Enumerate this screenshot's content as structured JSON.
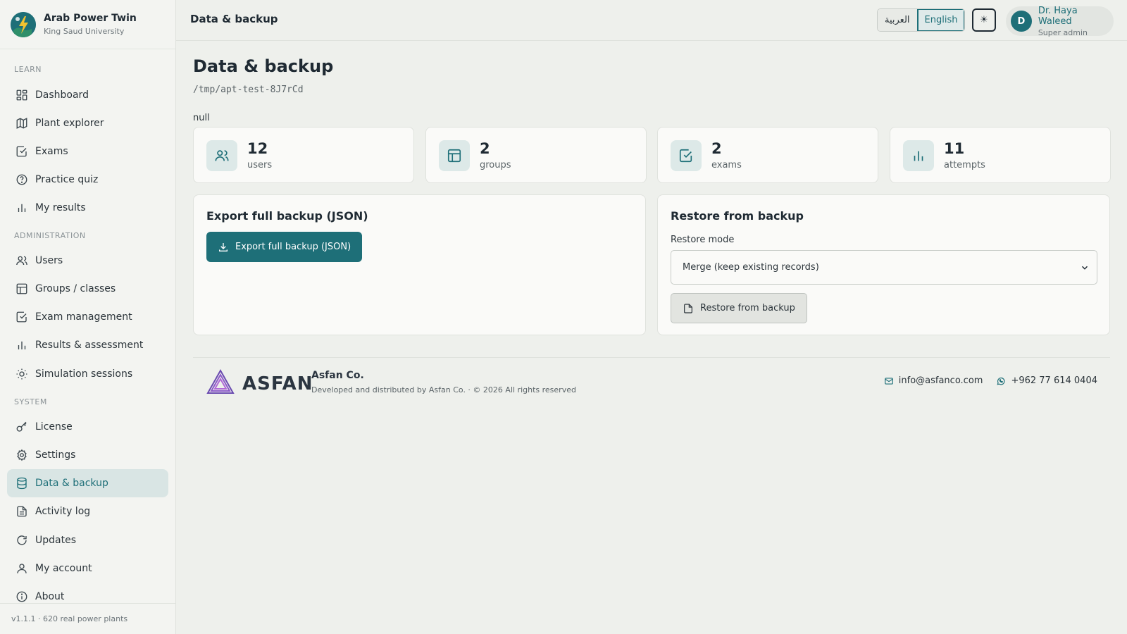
{
  "app": {
    "title": "Arab Power Twin",
    "org": "King Saud University",
    "version": "v1.1.1 · 620 real power plants"
  },
  "colors": {
    "accent": "#1e6f78",
    "background": "#eef0ec",
    "card": "#fafaf8"
  },
  "sidebar": {
    "sections": {
      "learn": "LEARN",
      "admin": "ADMINISTRATION",
      "system": "SYSTEM"
    },
    "items": [
      {
        "label": "Dashboard",
        "icon": "dashboard-icon"
      },
      {
        "label": "Plant explorer",
        "icon": "map-icon"
      },
      {
        "label": "Exams",
        "icon": "checkbox-icon"
      },
      {
        "label": "Practice quiz",
        "icon": "help-circle-icon"
      },
      {
        "label": "My results",
        "icon": "bar-chart-icon"
      },
      {
        "label": "Users",
        "icon": "users-icon"
      },
      {
        "label": "Groups / classes",
        "icon": "table-icon"
      },
      {
        "label": "Exam management",
        "icon": "checkbox-icon"
      },
      {
        "label": "Results & assessment",
        "icon": "bar-chart-icon"
      },
      {
        "label": "Simulation sessions",
        "icon": "sun-icon"
      },
      {
        "label": "License",
        "icon": "key-icon"
      },
      {
        "label": "Settings",
        "icon": "gear-icon"
      },
      {
        "label": "Data & backup",
        "icon": "database-icon",
        "active": true
      },
      {
        "label": "Activity log",
        "icon": "file-text-icon"
      },
      {
        "label": "Updates",
        "icon": "refresh-icon"
      },
      {
        "label": "My account",
        "icon": "user-icon"
      },
      {
        "label": "About",
        "icon": "info-icon"
      }
    ]
  },
  "header": {
    "title": "Data & backup",
    "lang_ar": "العربية",
    "lang_en": "English",
    "theme_glyph": "☀",
    "user_initial": "D",
    "user_name": "Dr. Haya Waleed",
    "user_role": "Super admin"
  },
  "main": {
    "title": "Data & backup",
    "path": "/tmp/apt-test-8J7rCd",
    "null_text": "null",
    "stats": [
      {
        "value": "12",
        "label": "users",
        "icon": "users-icon"
      },
      {
        "value": "2",
        "label": "groups",
        "icon": "table-icon"
      },
      {
        "value": "2",
        "label": "exams",
        "icon": "checkbox-icon"
      },
      {
        "value": "11",
        "label": "attempts",
        "icon": "bar-chart-icon"
      }
    ],
    "export": {
      "title": "Export full backup (JSON)",
      "button": "Export full backup (JSON)"
    },
    "restore": {
      "title": "Restore from backup",
      "mode_label": "Restore mode",
      "mode_value": "Merge (keep existing records)",
      "button": "Restore from backup"
    }
  },
  "footer": {
    "brand_word": "ASFAN",
    "company": "Asfan Co.",
    "rights": "Developed and distributed by Asfan Co. · © 2026 All rights reserved",
    "email": "info@asfanco.com",
    "phone": "+962 77 614 0404"
  }
}
